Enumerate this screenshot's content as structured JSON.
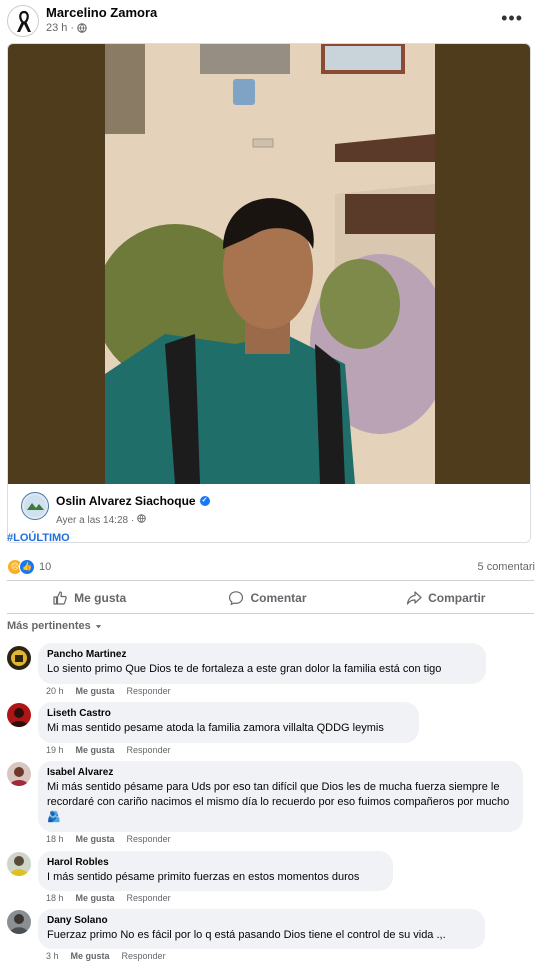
{
  "post": {
    "author": "Marcelino Zamora",
    "time": "23 h",
    "separator": "·",
    "more_label": "•••"
  },
  "shared": {
    "author": "Oslin Alvarez Siachoque",
    "verified_mark": "✓",
    "time": "Ayer a las 14:28",
    "separator": "·",
    "hashtag": "#LOÚLTIMO"
  },
  "reactions": {
    "count": "10",
    "comments": "5 comentari"
  },
  "actions": {
    "like": "Me gusta",
    "comment": "Comentar",
    "share": "Compartir"
  },
  "sort_label": "Más pertinentes",
  "comments": [
    {
      "name": "Pancho Martinez",
      "text": "Lo siento primo Que Dios te de fortaleza a este gran dolor la familia está con tigo",
      "time": "20 h",
      "like": "Me gusta",
      "reply": "Responder"
    },
    {
      "name": "Liseth Castro",
      "text": "Mi mas sentido pesame atoda la familia zamora villalta QDDG leymis",
      "time": "19 h",
      "like": "Me gusta",
      "reply": "Responder"
    },
    {
      "name": "Isabel Alvarez",
      "text": "Mi más sentido pésame para Uds por eso tan difícil que Dios les de mucha fuerza siempre le recordaré con cariño nacimos el mismo día lo recuerdo por eso fuimos compañeros por mucho 🫂",
      "time": "18 h",
      "like": "Me gusta",
      "reply": "Responder"
    },
    {
      "name": "Harol Robles",
      "text": "I más sentido pésame primito fuerzas en estos momentos duros",
      "time": "18 h",
      "like": "Me gusta",
      "reply": "Responder"
    },
    {
      "name": "Dany Solano",
      "text": "Fuerzaz primo No es fácil por lo q está pasando Dios tiene el control de su vida .,.",
      "time": "3 h",
      "like": "Me gusta",
      "reply": "Responder"
    }
  ],
  "colors": {
    "link": "#216fdb",
    "like_blue": "#1877f2",
    "secondary_text": "#65676b",
    "bubble": "#f0f2f5"
  }
}
